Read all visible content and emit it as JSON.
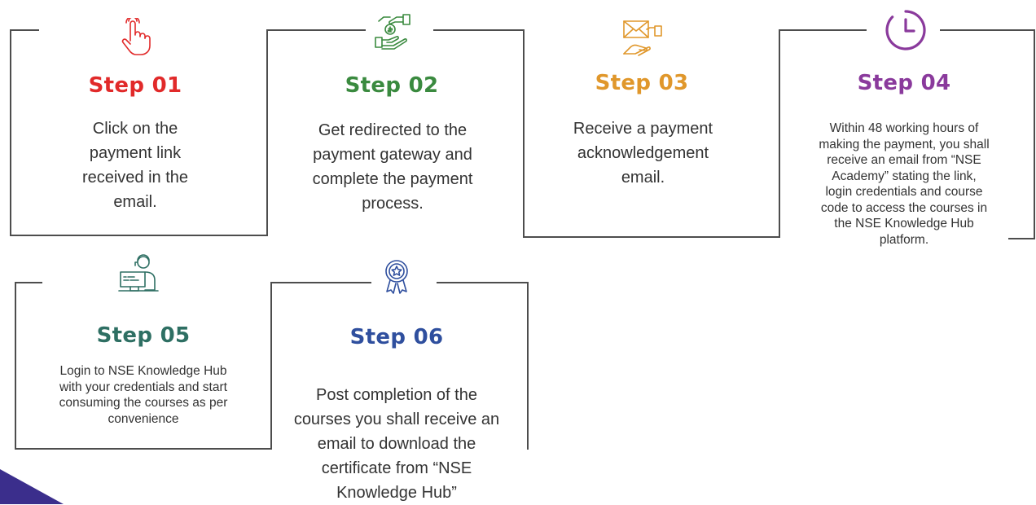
{
  "colors": {
    "line": "#4d4d4d",
    "accent_shape": "#3b2e8c",
    "step_01": "#e12a2a",
    "step_02": "#3a8a3f",
    "step_03": "#e0972b",
    "step_04": "#8a3a9c",
    "step_05": "#2e6f63",
    "step_06": "#2f4f9e"
  },
  "steps": [
    {
      "title": "Step 01",
      "icon": "hand-pointer-icon",
      "lines": [
        "Click on the",
        "payment link",
        "received in the",
        "email."
      ]
    },
    {
      "title": "Step 02",
      "icon": "handshake-payment-icon",
      "lines": [
        "Get redirected to the",
        "payment gateway and",
        "complete the payment",
        "process."
      ]
    },
    {
      "title": "Step 03",
      "icon": "envelope-hand-icon",
      "lines": [
        "Receive a payment",
        "acknowledgement",
        "email."
      ]
    },
    {
      "title": "Step 04",
      "icon": "clock-icon",
      "lines": [
        "Within 48 working hours of",
        "making the payment, you shall",
        "receive an email from “NSE",
        "Academy” stating the link,",
        "login credentials and course",
        "code to access the courses in",
        "the NSE Knowledge Hub",
        "platform."
      ]
    },
    {
      "title": "Step 05",
      "icon": "person-computer-icon",
      "lines": [
        "Login to NSE Knowledge Hub",
        "with your credentials and start",
        "consuming the courses as per",
        "convenience"
      ]
    },
    {
      "title": "Step 06",
      "icon": "award-badge-icon",
      "lines": [
        "Post completion of the",
        "courses you shall receive an",
        "email to download the",
        "certificate from “NSE",
        "Knowledge Hub”"
      ]
    }
  ]
}
